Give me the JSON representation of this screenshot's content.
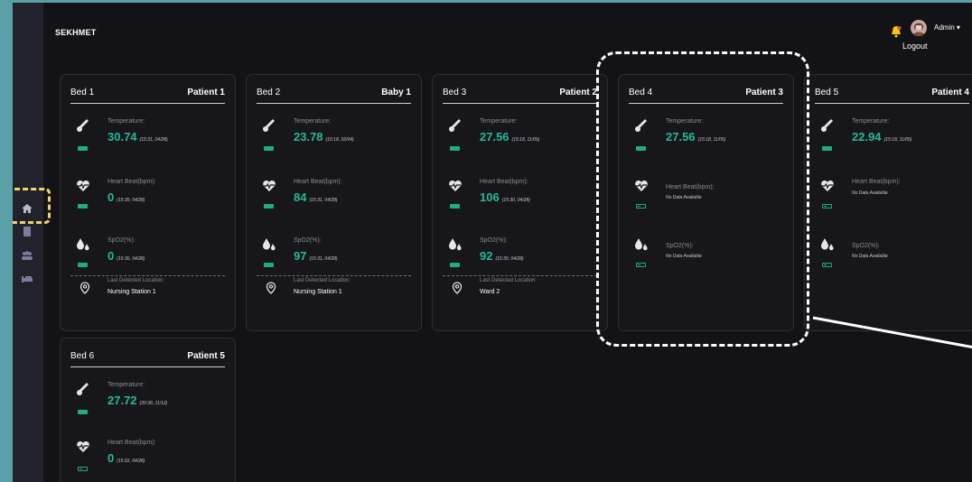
{
  "app": {
    "brand": "SEKHMET"
  },
  "user": {
    "name": "Admin ▾",
    "logout": "Logout"
  },
  "labels": {
    "temperature": "Temperature:",
    "heartbeat": "Heart Beat(bpm):",
    "spo2": "SpO2(%):",
    "location": "Last Detected Location:",
    "nodata": "No Data Available"
  },
  "colors": {
    "accent": "#25b89a",
    "battery": "#1fae7b",
    "highlight": "#f5d36b"
  },
  "cards": [
    {
      "bed": "Bed 1",
      "patient": "Patient 1",
      "temp": {
        "value": "30.74",
        "time": "(15:31, 04/28)"
      },
      "hb": {
        "value": "0",
        "time": "(15:30, 04/28)"
      },
      "spo2": {
        "value": "0",
        "time": "(15:30, 04/28)"
      },
      "location": "Nursing Station 1"
    },
    {
      "bed": "Bed 2",
      "patient": "Baby 1",
      "temp": {
        "value": "23.78",
        "time": "(10:18, 02/04)"
      },
      "hb": {
        "value": "84",
        "time": "(15:31, 04/28)"
      },
      "spo2": {
        "value": "97",
        "time": "(15:31, 04/28)"
      },
      "location": "Nursing Station 1"
    },
    {
      "bed": "Bed 3",
      "patient": "Patient 2",
      "temp": {
        "value": "27.56",
        "time": "(15:18, 11/05)"
      },
      "hb": {
        "value": "106",
        "time": "(15:30, 04/28)"
      },
      "spo2": {
        "value": "92",
        "time": "(15:30, 04/28)"
      },
      "location": "Ward 2"
    },
    {
      "bed": "Bed 4",
      "patient": "Patient 3",
      "temp": {
        "value": "27.56",
        "time": "(15:18, 11/05)"
      }
    },
    {
      "bed": "Bed 5",
      "patient": "Patient 4",
      "temp": {
        "value": "22.94",
        "time": "(15:18, 11/05)"
      }
    },
    {
      "bed": "Bed 6",
      "patient": "Patient 5",
      "temp": {
        "value": "27.72",
        "time": "(20:38, 11/12)"
      },
      "hb": {
        "value": "0",
        "time": "(15:22, 04/28)"
      }
    }
  ]
}
